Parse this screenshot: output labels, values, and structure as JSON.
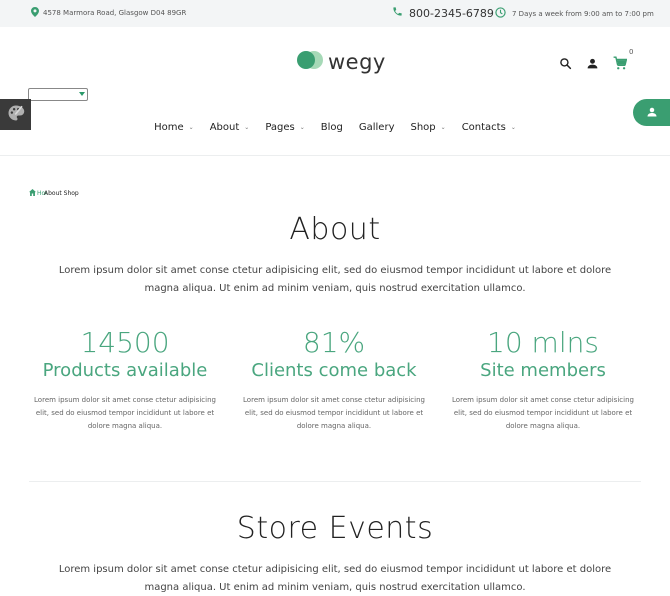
{
  "topbar": {
    "address": "4578 Marmora Road, Glasgow D04 89GR",
    "phone": "800-2345-6789",
    "hours": "7 Days a week from 9:00 am to 7:00 pm"
  },
  "logo": {
    "text": "wegy"
  },
  "cart": {
    "count": "0"
  },
  "nav": {
    "items": [
      {
        "label": "Home",
        "has_dropdown": true
      },
      {
        "label": "About",
        "has_dropdown": true
      },
      {
        "label": "Pages",
        "has_dropdown": true
      },
      {
        "label": "Blog",
        "has_dropdown": false
      },
      {
        "label": "Gallery",
        "has_dropdown": false
      },
      {
        "label": "Shop",
        "has_dropdown": true
      },
      {
        "label": "Contacts",
        "has_dropdown": true
      }
    ]
  },
  "breadcrumb": {
    "home": "Home",
    "current": "About Shop"
  },
  "about": {
    "title": "About",
    "text": "Lorem ipsum dolor sit amet conse ctetur adipisicing elit, sed do eiusmod tempor incididunt ut labore et dolore magna aliqua. Ut enim ad minim veniam, quis nostrud exercitation ullamco."
  },
  "stats": [
    {
      "number": "14500",
      "label": "Products available",
      "desc": "Lorem ipsum dolor sit amet conse ctetur adipisicing elit, sed do eiusmod tempor incididunt ut labore et dolore magna aliqua."
    },
    {
      "number": "81%",
      "label": "Clients come back",
      "desc": "Lorem ipsum dolor sit amet conse ctetur adipisicing elit, sed do eiusmod tempor incididunt ut labore et dolore magna aliqua."
    },
    {
      "number": "10 mlns",
      "label": "Site members",
      "desc": "Lorem ipsum dolor sit amet conse ctetur adipisicing elit, sed do eiusmod tempor incididunt ut labore et dolore magna aliqua."
    }
  ],
  "events": {
    "title": "Store Events",
    "text": "Lorem ipsum dolor sit amet conse ctetur adipisicing elit, sed do eiusmod tempor incididunt ut labore et dolore magna aliqua. Ut enim ad minim veniam, quis nostrud exercitation ullamco."
  },
  "colors": {
    "accent": "#3a9e71",
    "topbar_bg": "#f3f5f6",
    "dark_button": "#3a3a3a"
  },
  "icons": [
    "map-pin-icon",
    "phone-icon",
    "clock-icon",
    "search-icon",
    "user-icon",
    "cart-icon",
    "palette-icon",
    "home-icon",
    "chevron-down-icon"
  ]
}
